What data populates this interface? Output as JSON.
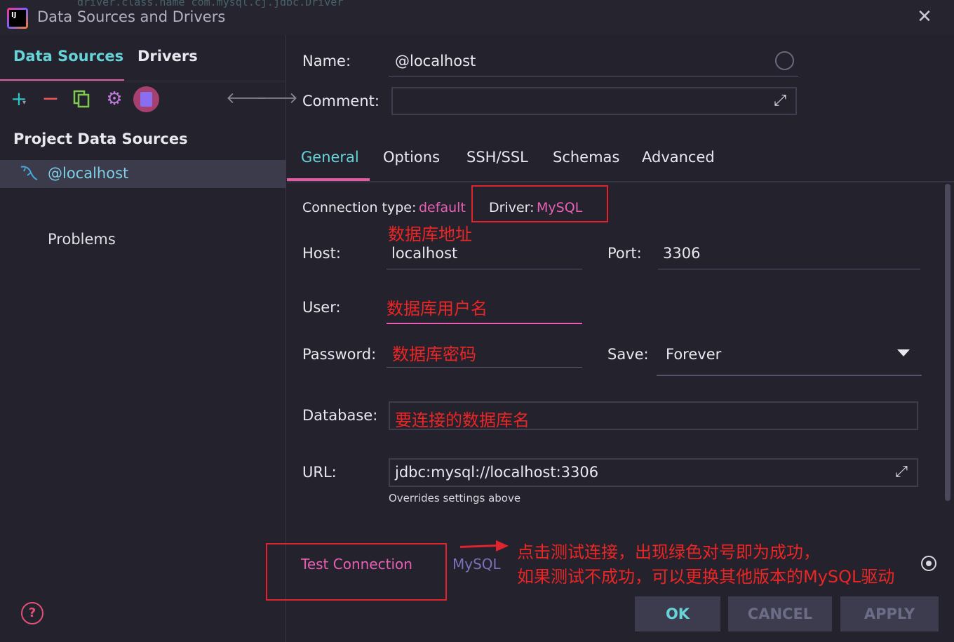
{
  "window": {
    "title": "Data Sources and Drivers",
    "ghost_text": "driver.class.name com.mysql.cj.jdbc.Driver",
    "logo_text": "IJ"
  },
  "left": {
    "tabs": [
      {
        "label": "Data Sources"
      },
      {
        "label": "Drivers"
      }
    ],
    "toolbar_icons": [
      "add-icon",
      "remove-icon",
      "duplicate-icon",
      "settings-icon",
      "ddl-icon",
      "back-icon",
      "forward-icon"
    ],
    "section_title": "Project Data Sources",
    "items": [
      {
        "label": "@localhost"
      }
    ],
    "problems_label": "Problems"
  },
  "form": {
    "name_label": "Name:",
    "name_value": "@localhost",
    "comment_label": "Comment:",
    "comment_value": "",
    "tabs": [
      {
        "label": "General"
      },
      {
        "label": "Options"
      },
      {
        "label": "SSH/SSL"
      },
      {
        "label": "Schemas"
      },
      {
        "label": "Advanced"
      }
    ],
    "connection_type_label": "Connection type:",
    "connection_type_value": "default",
    "driver_label": "Driver:",
    "driver_value": "MySQL",
    "host_label": "Host:",
    "host_value": "localhost",
    "port_label": "Port:",
    "port_value": "3306",
    "user_label": "User:",
    "user_value": "",
    "password_label": "Password:",
    "password_value": "",
    "save_label": "Save:",
    "save_value": "Forever",
    "database_label": "Database:",
    "database_value": "",
    "url_label": "URL:",
    "url_value": "jdbc:mysql://localhost:3306",
    "url_note": "Overrides settings above"
  },
  "annotations": {
    "host": "数据库地址",
    "user": "数据库用户名",
    "password": "数据库密码",
    "database": "要连接的数据库名",
    "test_line1": "点击测试连接，出现绿色对号即为成功，",
    "test_line2": "如果测试不成功，可以更换其他版本的MySQL驱动"
  },
  "footer": {
    "test_connection": "Test Connection",
    "driver_link": "MySQL",
    "ok": "OK",
    "cancel": "CANCEL",
    "apply": "APPLY"
  },
  "colors": {
    "accent_cyan": "#66d3d8",
    "accent_pink": "#e860b4",
    "annotation_red": "#e0232d",
    "background": "#23222d"
  }
}
